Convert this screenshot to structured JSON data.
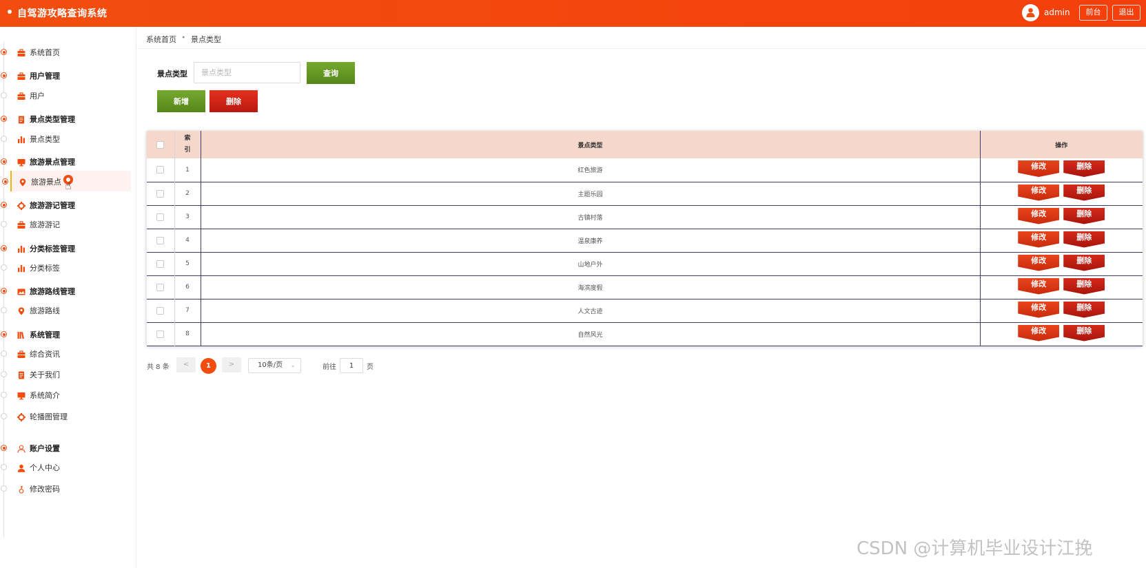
{
  "header": {
    "title": "自驾游攻略查询系统",
    "username": "admin",
    "front_label": "前台",
    "logout_label": "退出"
  },
  "sidebar": {
    "items": [
      {
        "label": "系统首页",
        "group": false,
        "icon": "briefcase-icon"
      },
      {
        "label": "用户管理",
        "group": true,
        "icon": "briefcase-icon"
      },
      {
        "label": "用户",
        "group": false,
        "icon": "briefcase-icon"
      },
      {
        "label": "景点类型管理",
        "group": true,
        "icon": "document-icon"
      },
      {
        "label": "景点类型",
        "group": false,
        "icon": "bar-chart-icon"
      },
      {
        "label": "旅游景点管理",
        "group": true,
        "icon": "monitor-icon"
      },
      {
        "label": "旅游景点",
        "group": false,
        "icon": "map-pin-icon",
        "active": true
      },
      {
        "label": "旅游游记管理",
        "group": true,
        "icon": "gear-icon"
      },
      {
        "label": "旅游游记",
        "group": false,
        "icon": "briefcase-icon"
      },
      {
        "label": "分类标签管理",
        "group": true,
        "icon": "bar-chart-icon"
      },
      {
        "label": "分类标签",
        "group": false,
        "icon": "bar-chart-icon"
      },
      {
        "label": "旅游路线管理",
        "group": true,
        "icon": "picture-icon"
      },
      {
        "label": "旅游路线",
        "group": false,
        "icon": "map-pin-icon"
      },
      {
        "label": "系统管理",
        "group": true,
        "icon": "library-icon"
      },
      {
        "label": "综合资讯",
        "group": false,
        "icon": "briefcase-icon"
      },
      {
        "label": "关于我们",
        "group": false,
        "icon": "document-icon"
      },
      {
        "label": "系统简介",
        "group": false,
        "icon": "monitor-icon"
      },
      {
        "label": "轮播图管理",
        "group": false,
        "icon": "gear-icon"
      },
      {
        "label": "账户设置",
        "group": true,
        "icon": "user-outline-icon"
      },
      {
        "label": "个人中心",
        "group": false,
        "icon": "user-icon"
      },
      {
        "label": "修改密码",
        "group": false,
        "icon": "key-icon"
      }
    ]
  },
  "breadcrumb": {
    "home": "系统首页",
    "separator": "•",
    "current": "景点类型"
  },
  "search": {
    "label": "景点类型",
    "placeholder": "景点类型",
    "value": "",
    "query_label": "查询"
  },
  "actions": {
    "add_label": "新增",
    "delete_label": "删除"
  },
  "table": {
    "headers": {
      "index": "索引",
      "type": "景点类型",
      "ops": "操作"
    },
    "edit_label": "修改",
    "delete_label": "删除",
    "rows": [
      {
        "index": "1",
        "type": "红色旅游"
      },
      {
        "index": "2",
        "type": "主题乐园"
      },
      {
        "index": "3",
        "type": "古镇村落"
      },
      {
        "index": "4",
        "type": "温泉康养"
      },
      {
        "index": "5",
        "type": "山地户外"
      },
      {
        "index": "6",
        "type": "海滨度假"
      },
      {
        "index": "7",
        "type": "人文古迹"
      },
      {
        "index": "8",
        "type": "自然风光"
      }
    ]
  },
  "pagination": {
    "total": "共 8 条",
    "prev": "<",
    "next": ">",
    "current_page": "1",
    "page_size": "10条/页",
    "goto_label": "前往",
    "goto_value": "1",
    "page_unit": "页"
  },
  "watermark": "CSDN @计算机毕业设计江挽",
  "colors": {
    "primary": "#f24d0f",
    "green": "#5e9322",
    "red": "#c41f13",
    "header_row": "#f5d7cc"
  }
}
